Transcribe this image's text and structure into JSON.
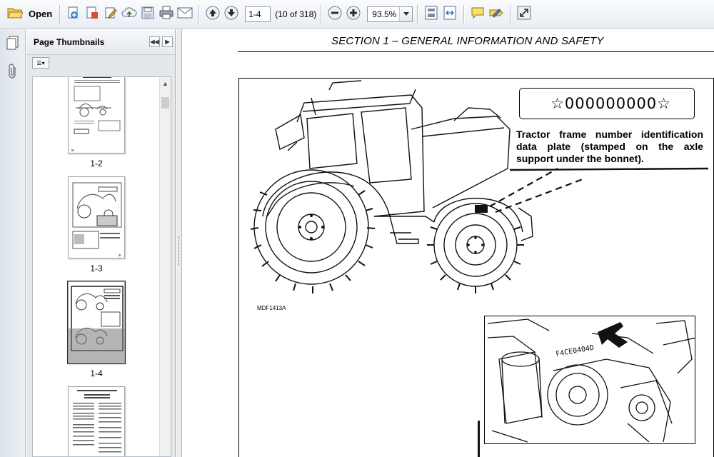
{
  "toolbar": {
    "open_label": "Open",
    "page_input": "1-4",
    "page_count": "(10 of 318)",
    "zoom_value": "93.5%"
  },
  "panel": {
    "title": "Page Thumbnails",
    "thumbnails": [
      {
        "label": "1-2"
      },
      {
        "label": "1-3"
      },
      {
        "label": "1-4",
        "selected": true
      },
      {
        "label": ""
      }
    ]
  },
  "document": {
    "section_title": "SECTION 1 – GENERAL INFORMATION AND SAFETY",
    "serial_plate": "☆000000000☆",
    "callout_text": "Tractor frame number identification data plate (stamped on the axle support under the bonnet).",
    "figure_code": "MDF1413A",
    "engine_stamp": "F4CE0404D"
  },
  "icons": [
    "open-folder-icon",
    "save-icon",
    "print-icon",
    "email-icon",
    "prev-page-icon",
    "next-page-icon",
    "zoom-out-icon",
    "zoom-in-icon",
    "fit-page-icon",
    "comment-icon",
    "sign-icon",
    "expand-icon",
    "pages-icon",
    "attachment-icon"
  ]
}
